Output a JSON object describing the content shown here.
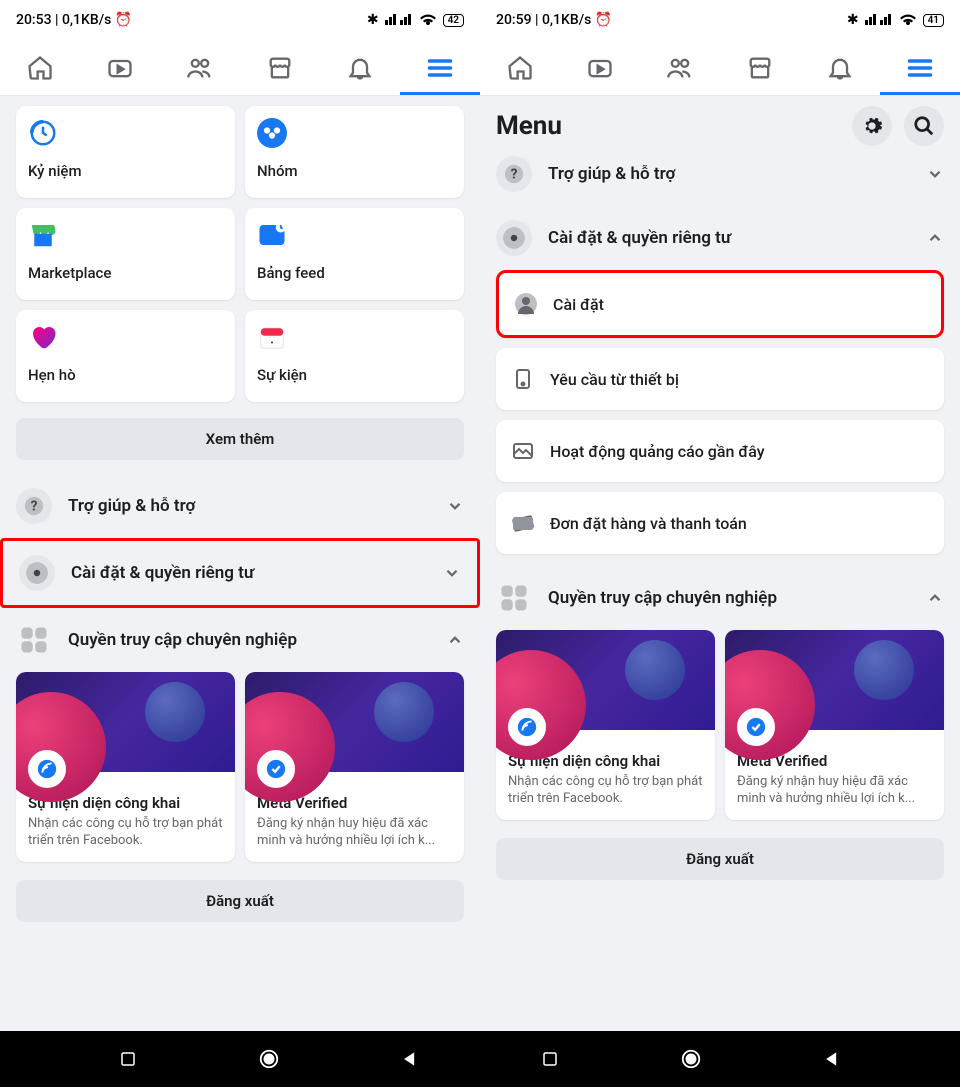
{
  "screen1": {
    "status": {
      "time": "20:53 | 0,1KB/s ⏰",
      "battery": "42"
    },
    "shortcuts": [
      {
        "label": "Kỷ niệm"
      },
      {
        "label": "Nhóm"
      },
      {
        "label": "Marketplace"
      },
      {
        "label": "Bảng feed"
      },
      {
        "label": "Hẹn hò"
      },
      {
        "label": "Sự kiện"
      }
    ],
    "see_more": "Xem thêm",
    "rows": {
      "help": "Trợ giúp & hỗ trợ",
      "settings": "Cài đặt & quyền riêng tư",
      "pro": "Quyền truy cập chuyên nghiệp"
    },
    "logout": "Đăng xuất"
  },
  "screen2": {
    "status": {
      "time": "20:59 | 0,1KB/s ⏰",
      "battery": "41"
    },
    "menu_title": "Menu",
    "rows": {
      "help": "Trợ giúp & hỗ trợ",
      "settings": "Cài đặt & quyền riêng tư",
      "pro": "Quyền truy cập chuyên nghiệp"
    },
    "settings_items": [
      "Cài đặt",
      "Yêu cầu từ thiết bị",
      "Hoạt động quảng cáo gần đây",
      "Đơn đặt hàng và thanh toán"
    ],
    "logout": "Đăng xuất"
  },
  "pro_cards": [
    {
      "title": "Sự hiện diện công khai",
      "desc": "Nhận các công cụ hỗ trợ bạn phát triển trên Facebook."
    },
    {
      "title": "Meta Verified",
      "desc": "Đăng ký nhận huy hiệu đã xác minh và hưởng nhiều lợi ích k..."
    }
  ]
}
